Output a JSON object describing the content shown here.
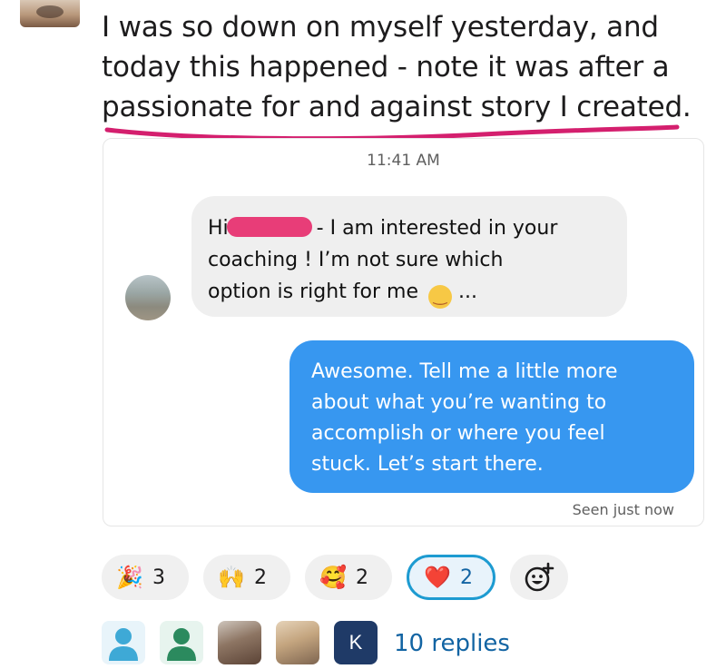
{
  "post": {
    "lines": [
      "I was so down on myself yesterday, and",
      "today this happened - note it was after a",
      "passionate for and against story I created."
    ]
  },
  "dm": {
    "timestamp": "11:41 AM",
    "incoming": {
      "line1_start": "Hi",
      "line1_end": " - I am interested in your",
      "line2": "coaching ! I’m not sure which",
      "line3": "option is right for me",
      "line3_end": " ..."
    },
    "outgoing": {
      "lines": [
        "Awesome.  Tell me a little more",
        "about what you’re wanting to",
        "accomplish or where you feel",
        "stuck.  Let’s start there."
      ]
    },
    "seen": "Seen just now"
  },
  "reactions": [
    {
      "icon": "party-popper-icon",
      "emoji": "🎉",
      "count": "3"
    },
    {
      "icon": "raising-hands-icon",
      "emoji": "🙌",
      "count": "2"
    },
    {
      "icon": "smiling-face-with-hearts-icon",
      "emoji": "🥰",
      "count": "2"
    },
    {
      "icon": "red-heart-icon",
      "emoji": "❤️",
      "count": "2",
      "active": true
    }
  ],
  "replies": {
    "label": "10 replies",
    "k_avatar_letter": "K"
  },
  "colors": {
    "accent_pink": "#d41f6e",
    "bubble_blue": "#3797f0",
    "link_blue": "#1264a3",
    "active_reaction_border": "#1d9bd1"
  }
}
